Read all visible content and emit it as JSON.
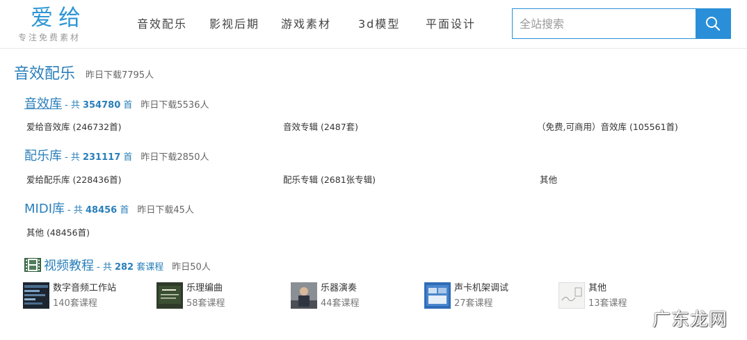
{
  "logo": {
    "main": "爱给",
    "tagline": "专注免费素材"
  },
  "nav": [
    "音效配乐",
    "影视后期",
    "游戏素材",
    "3d模型",
    "平面设计"
  ],
  "search": {
    "placeholder": "全站搜索",
    "value": ""
  },
  "section": {
    "title": "音效配乐",
    "subtitle": "昨日下载7795人"
  },
  "categories": [
    {
      "name": "音效库",
      "count_prefix": "- 共 ",
      "count": "354780",
      "count_suffix": " 首",
      "downloads": "昨日下载5536人",
      "links": [
        "爱给音效库 (246732首)",
        "音效专辑 (2487套)",
        "（免费,可商用）音效库 (105561首)"
      ]
    },
    {
      "name": "配乐库",
      "count_prefix": "- 共 ",
      "count": "231117",
      "count_suffix": " 首",
      "downloads": "昨日下载2850人",
      "links": [
        "爱给配乐库 (228436首)",
        "配乐专辑 (2681张专辑)",
        "其他"
      ]
    },
    {
      "name": "MIDI库",
      "count_prefix": "- 共 ",
      "count": "48456",
      "count_suffix": " 首",
      "downloads": "昨日下载45人",
      "links": [
        "其他 (48456首)"
      ]
    }
  ],
  "video": {
    "name": "视频教程",
    "count_prefix": "- 共 ",
    "count": "282",
    "count_suffix": " 套课程",
    "downloads": "昨日50人",
    "courses": [
      {
        "name": "数字音频工作站",
        "count": "140套课程"
      },
      {
        "name": "乐理编曲",
        "count": "58套课程"
      },
      {
        "name": "乐器演奏",
        "count": "44套课程"
      },
      {
        "name": "声卡机架调试",
        "count": "27套课程"
      },
      {
        "name": "其他",
        "count": "13套课程"
      }
    ]
  },
  "watermark": "广东龙网",
  "colors": {
    "brand": "#2a8fd8",
    "link": "#2a7fba",
    "logo": "#2e96d6"
  }
}
